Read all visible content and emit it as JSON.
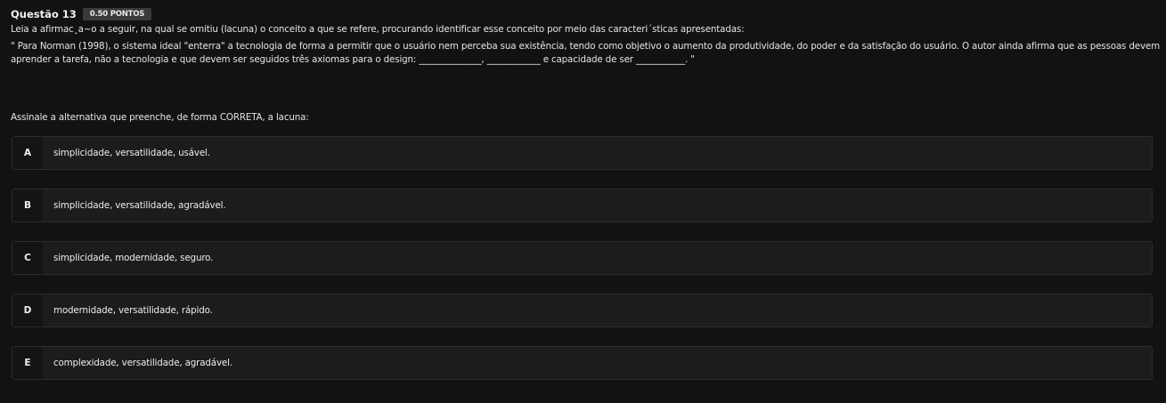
{
  "question": {
    "title": "Questão 13",
    "points_badge": "0.50 PONTOS",
    "instruction": "Leia a afirmac¸a~o a seguir, na qual se omitiu (lacuna) o conceito a que se refere, procurando identificar esse conceito por meio das caracteri´sticas apresentadas:",
    "quote": "\" Para Norman (1998), o sistema ideal \"enterra\" a tecnologia de forma a permitir que o usuário nem perceba sua existência, tendo como objetivo o aumento da produtividade, do poder e da satisfação do usuário. O autor ainda afirma que as pessoas devem aprender a tarefa, não a tecnologia e que devem ser seguidos três axiomas para o design: ______________, ____________ e capacidade de ser ___________. \"",
    "prompt": "Assinale a alternativa que preenche, de forma CORRETA, a lacuna:"
  },
  "options": [
    {
      "letter": "A",
      "text": "simplicidade, versatilidade, usável."
    },
    {
      "letter": "B",
      "text": "simplicidade, versatilidade, agradável."
    },
    {
      "letter": "C",
      "text": "simplicidade, modernidade, seguro."
    },
    {
      "letter": "D",
      "text": "modernidade, versatilidade, rápido."
    },
    {
      "letter": "E",
      "text": "complexidade, versatilidade, agradável."
    }
  ]
}
